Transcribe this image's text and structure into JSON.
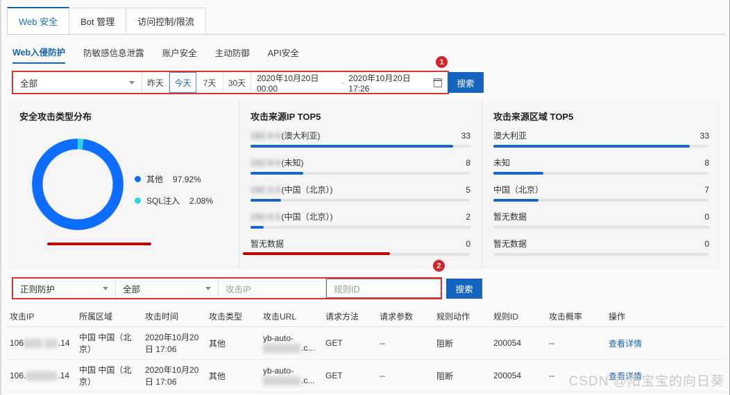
{
  "tabs": [
    {
      "label": "Web 安全",
      "active": true
    },
    {
      "label": "Bot 管理",
      "active": false
    },
    {
      "label": "访问控制/限流",
      "active": false
    }
  ],
  "subnav": [
    {
      "label": "Web入侵防护",
      "active": true
    },
    {
      "label": "防敏感信息泄露",
      "active": false
    },
    {
      "label": "账户安全",
      "active": false
    },
    {
      "label": "主动防御",
      "active": false
    },
    {
      "label": "API安全",
      "active": false
    }
  ],
  "filter1": {
    "domain_select": "全部",
    "quick_ranges": [
      {
        "label": "昨天",
        "active": false
      },
      {
        "label": "今天",
        "active": true
      },
      {
        "label": "7天",
        "active": false
      },
      {
        "label": "30天",
        "active": false
      }
    ],
    "date_start": "2020年10月20日 00:00",
    "date_sep": "-",
    "date_end": "2020年10月20日 17:26",
    "search_label": "搜索",
    "badge": "1"
  },
  "filter2": {
    "protect_select": "正则防护",
    "action_select": "全部",
    "ip_placeholder": "攻击IP",
    "rule_placeholder": "规则ID",
    "search_label": "搜索",
    "badge": "2"
  },
  "panels": {
    "pie_title": "安全攻击类型分布",
    "ip_title": "攻击来源IP TOP5",
    "region_title": "攻击来源区域 TOP5"
  },
  "chart_data": [
    {
      "type": "pie",
      "title": "安全攻击类型分布",
      "categories": [
        "其他",
        "SQL注入"
      ],
      "values": [
        97.92,
        2.08
      ],
      "value_labels": [
        "97.92%",
        "2.08%"
      ],
      "colors": [
        "#0d6efd",
        "#2bd6e0"
      ],
      "legend_position": "right"
    },
    {
      "type": "bar",
      "title": "攻击来源IP TOP5",
      "orientation": "horizontal",
      "categories": [
        "(澳大利亚)",
        "(未知)",
        "(中国（北京）)",
        "(中国（北京）)",
        "暂无数据"
      ],
      "label_prefix_blurred": [
        true,
        true,
        true,
        true,
        false
      ],
      "values": [
        33,
        8,
        5,
        2,
        0
      ],
      "pct": [
        92,
        24,
        14,
        6,
        0
      ],
      "bar_color": "#1667cc"
    },
    {
      "type": "bar",
      "title": "攻击来源区域 TOP5",
      "orientation": "horizontal",
      "categories": [
        "澳大利亚",
        "未知",
        "中国（北京）",
        "暂无数据",
        "暂无数据"
      ],
      "label_prefix_blurred": [
        false,
        false,
        false,
        false,
        false
      ],
      "values": [
        33,
        8,
        7,
        0,
        0
      ],
      "pct": [
        91,
        23,
        21,
        0,
        0
      ],
      "bar_color": "#1667cc"
    }
  ],
  "table": {
    "headers": [
      "攻击IP",
      "所属区域",
      "攻击时间",
      "攻击类型",
      "攻击URL",
      "请求方法",
      "请求参数",
      "规则动作",
      "规则ID",
      "攻击概率",
      "操作"
    ],
    "rows": [
      {
        "ip_prefix": "106",
        "ip_blur": "▒▒▒ ▒▒",
        "ip_suffix": ".14",
        "region": "中国 中国（北京）",
        "time": "2020年10月20日 17:06",
        "attack_type": "其他",
        "url_prefix": "yb-auto-",
        "url_blur": "▒▒▒▒▒▒",
        "url_suffix": ".c...",
        "method": "GET",
        "params": "--",
        "action": "阻断",
        "rule_id": "200054",
        "probability": "--",
        "op": "查看详情"
      },
      {
        "ip_prefix": "106.",
        "ip_blur": "▒▒▒▒▒",
        "ip_suffix": ".14",
        "region": "中国 中国（北京）",
        "time": "2020年10月20日 17:06",
        "attack_type": "其他",
        "url_prefix": "yb-auto-",
        "url_blur": "▒▒▒▒▒▒",
        "url_suffix": ".c...",
        "method": "GET",
        "params": "--",
        "action": "阻断",
        "rule_id": "200054",
        "probability": "--",
        "op": "查看详情"
      }
    ]
  },
  "watermark": "CSDN @阳宝宝的向日葵"
}
